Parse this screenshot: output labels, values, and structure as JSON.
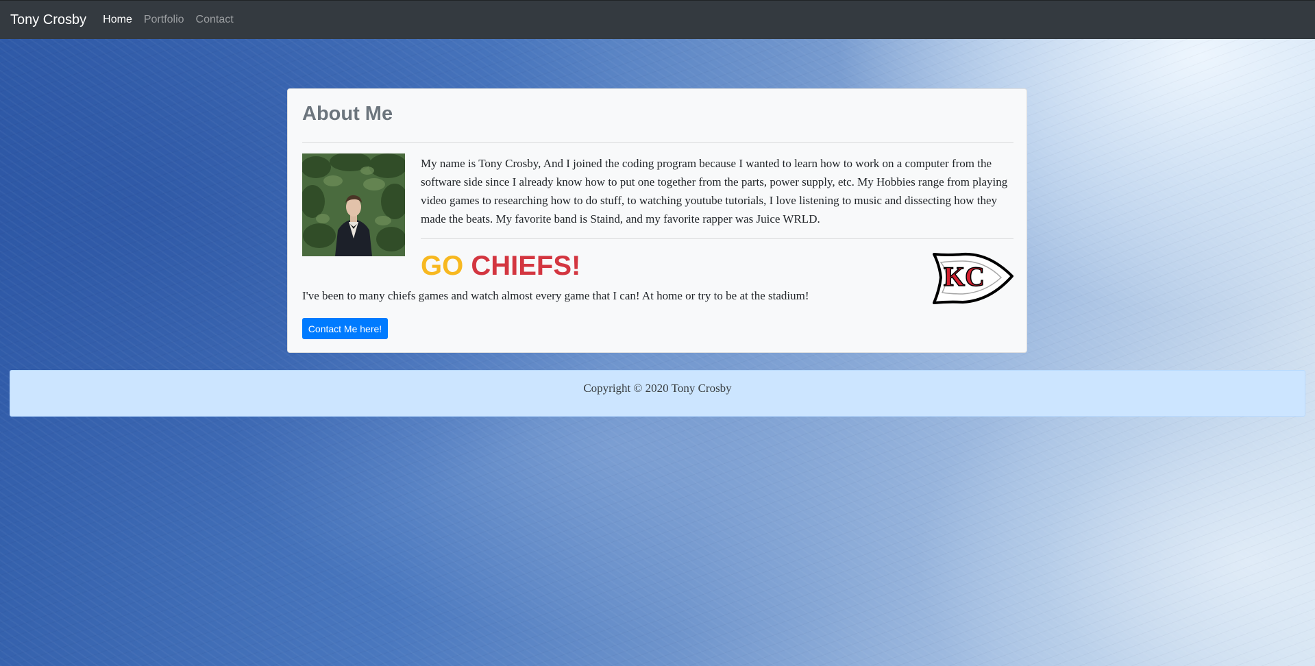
{
  "navbar": {
    "brand": "Tony Crosby",
    "links": [
      {
        "label": "Home",
        "active": true
      },
      {
        "label": "Portfolio",
        "active": false
      },
      {
        "label": "Contact",
        "active": false
      }
    ]
  },
  "about": {
    "title": "About Me",
    "bio": "My name is Tony Crosby, And I joined the coding program because I wanted to learn how to work on a computer from the software side since I already know how to put one together from the parts, power supply, etc. My Hobbies range from playing video games to researching how to do stuff, to watching youtube tutorials, I love listening to music and dissecting how they made the beats. My favorite band is Staind, and my favorite rapper was Juice WRLD.",
    "go_word": "GO",
    "chiefs_word": "CHIEFS!",
    "logo_letters": "KC",
    "stadium_text": "I've been to many chiefs games and watch almost every game that I can! At home or try to be at the stadium!",
    "button_label": "Contact Me here!"
  },
  "footer": {
    "copyright": "Copyright © 2020 Tony Crosby"
  },
  "colors": {
    "navbar_bg": "#343a40",
    "go_yellow": "#f7b820",
    "chiefs_red": "#d33640",
    "button_blue": "#007bff",
    "footer_bg": "#cce5ff"
  }
}
